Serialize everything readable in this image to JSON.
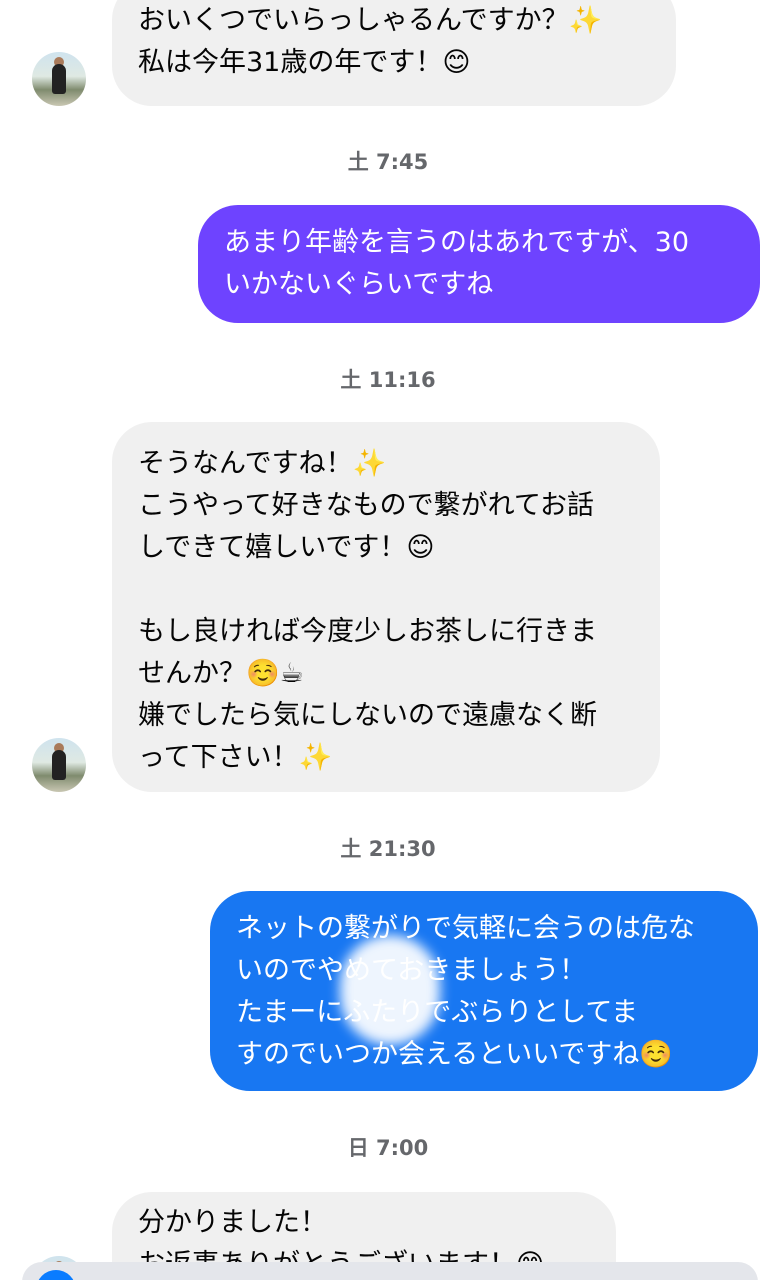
{
  "colors": {
    "incoming_bg": "#f0f0f0",
    "outgoing_purple": "#6e43ff",
    "outgoing_blue": "#1877f2",
    "timestamp": "#65676b"
  },
  "messages": [
    {
      "lines": "おいくつでいらっしゃるんですか？✨\n私は今年31歳の年です！😊"
    },
    {
      "timestamp": "土 7:45"
    },
    {
      "lines": "あまり年齢を言うのはあれですが、30\nいかないぐらいですね"
    },
    {
      "timestamp": "土 11:16"
    },
    {
      "lines": "そうなんですね！✨\nこうやって好きなもので繋がれてお話\nしできて嬉しいです！😊\n\nもし良ければ今度少しお茶しに行きま\nせんか？☺️☕\n嫌でしたら気にしないので遠慮なく断\nって下さい！✨"
    },
    {
      "timestamp": "土 21:30"
    },
    {
      "lines": "ネットの繋がりで気軽に会うのは危な\nいのでやめておきましょう！\nたまーにふたりでぶらりとしてま\nすのでいつか会えるといいですね☺️"
    },
    {
      "timestamp": "日 7:00"
    },
    {
      "lines": "分かりました！\nお返事ありがとうございます！😊"
    }
  ]
}
